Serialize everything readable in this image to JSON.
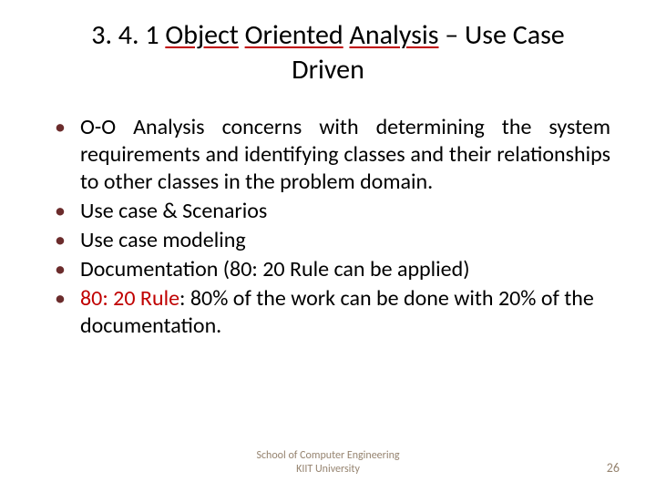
{
  "title": {
    "prefix": "3. 4. 1 ",
    "word1": "Object",
    "space1": " ",
    "word2": "Oriented",
    "space2": " ",
    "word3": "Analysis",
    "suffix": " – Use Case Driven"
  },
  "bullets": [
    "O-O Analysis concerns with determining the system requirements and identifying classes and their relationships to other classes in the problem domain.",
    "Use case & Scenarios",
    "Use case modeling",
    "Documentation (80: 20 Rule can be applied)"
  ],
  "bullet5": {
    "label": "80: 20 Rule",
    "rest": ": 80% of the work can be done with 20% of the documentation."
  },
  "footer": {
    "line1": "School of Computer Engineering",
    "line2": "KIIT University"
  },
  "pageNumber": "26"
}
